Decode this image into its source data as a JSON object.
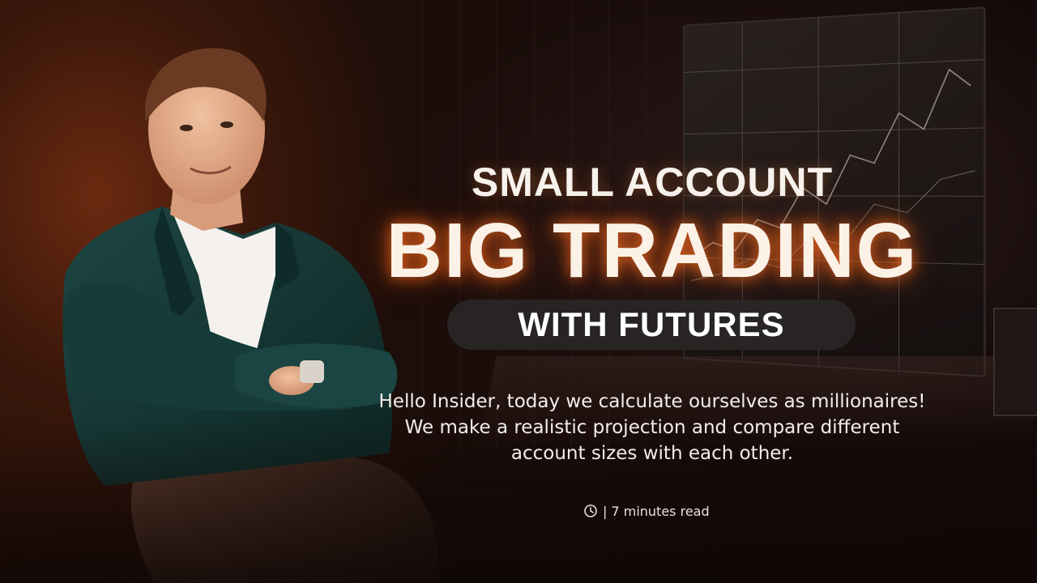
{
  "hero": {
    "title_small": "SMALL ACCOUNT",
    "title_big": "BIG TRADING",
    "title_pill": "WITH FUTURES",
    "description_lines": [
      "Hello Insider, today we calculate ourselves as millionaires!",
      "We make a realistic projection and compare different",
      "account sizes with each other."
    ],
    "read_time": "| 7 minutes read",
    "read_time_icon": "clock-icon"
  },
  "colors": {
    "accent_glow": "#ff6e1e",
    "text": "#fbf1e6",
    "pill_bg": "#2a2626"
  },
  "images": {
    "presenter": "man-in-dark-suit-arms-crossed",
    "background": "trading-desk-with-monitors"
  }
}
